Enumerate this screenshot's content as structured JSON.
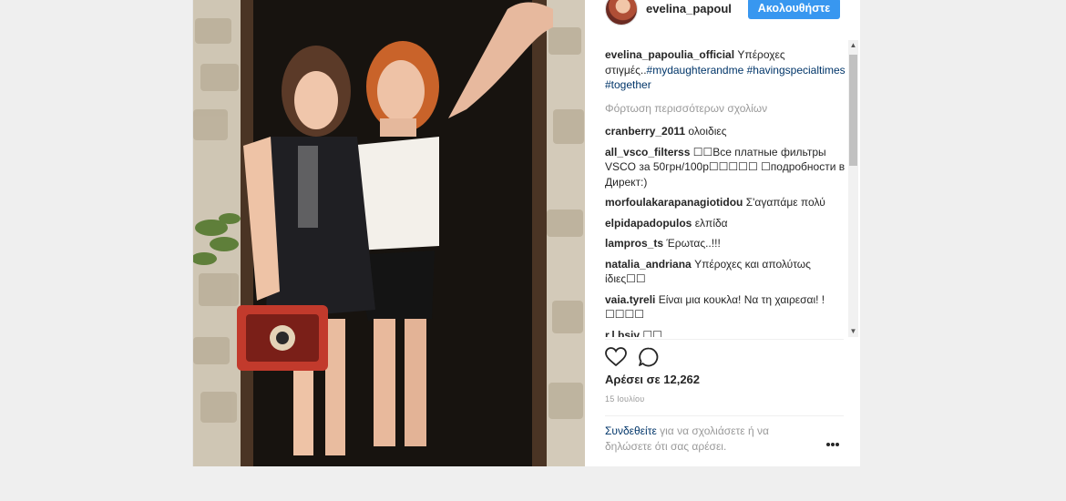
{
  "post": {
    "author": "evelina_papoul",
    "follow_label": "Ακολουθήστε",
    "caption": {
      "user": "evelina_papoulia_official",
      "text": "Υπέροχες στιγμές..",
      "tags": [
        "#mydaughterandme",
        "#havingspecialtimes",
        "#together"
      ]
    },
    "load_more": "Φόρτωση περισσότερων σχολίων",
    "comments": [
      {
        "user": "cranberry_2011",
        "text": "ολοιδιες"
      },
      {
        "user": "all_vsco_filterss",
        "text": "☐☐Все платные фильтры VSCO за 50грн/100р☐☐☐☐☐ ☐подробности в Директ:)"
      },
      {
        "user": "morfoulakarapanagiotidou",
        "text": "Σ'αγαπάμε πολύ"
      },
      {
        "user": "elpidapadopulos",
        "text": "ελπίδα"
      },
      {
        "user": "lampros_ts",
        "text": "Έρωτας..!!!"
      },
      {
        "user": "natalia_andriana",
        "text": "Υπέροχες και απολύτως ίδιες☐☐"
      },
      {
        "user": "vaia.tyreli",
        "text": "Είναι μια κουκλα! Να τη χαιρεσαι! ! ☐☐☐☐"
      },
      {
        "user": "r.l.bsiv",
        "text": "☐☐"
      }
    ],
    "likes": "Αρέσει σε 12,262",
    "date": "15 Ιουλίου",
    "login_note": {
      "link": "Συνδεθείτε",
      "text": " για να σχολιάσετε ή να δηλώσετε ότι σας αρέσει."
    }
  },
  "icons": {
    "like": "heart-icon",
    "comment": "comment-icon",
    "more": "more-options-icon"
  },
  "colors": {
    "accent": "#3897f0",
    "link": "#003569",
    "muted": "#999999"
  }
}
